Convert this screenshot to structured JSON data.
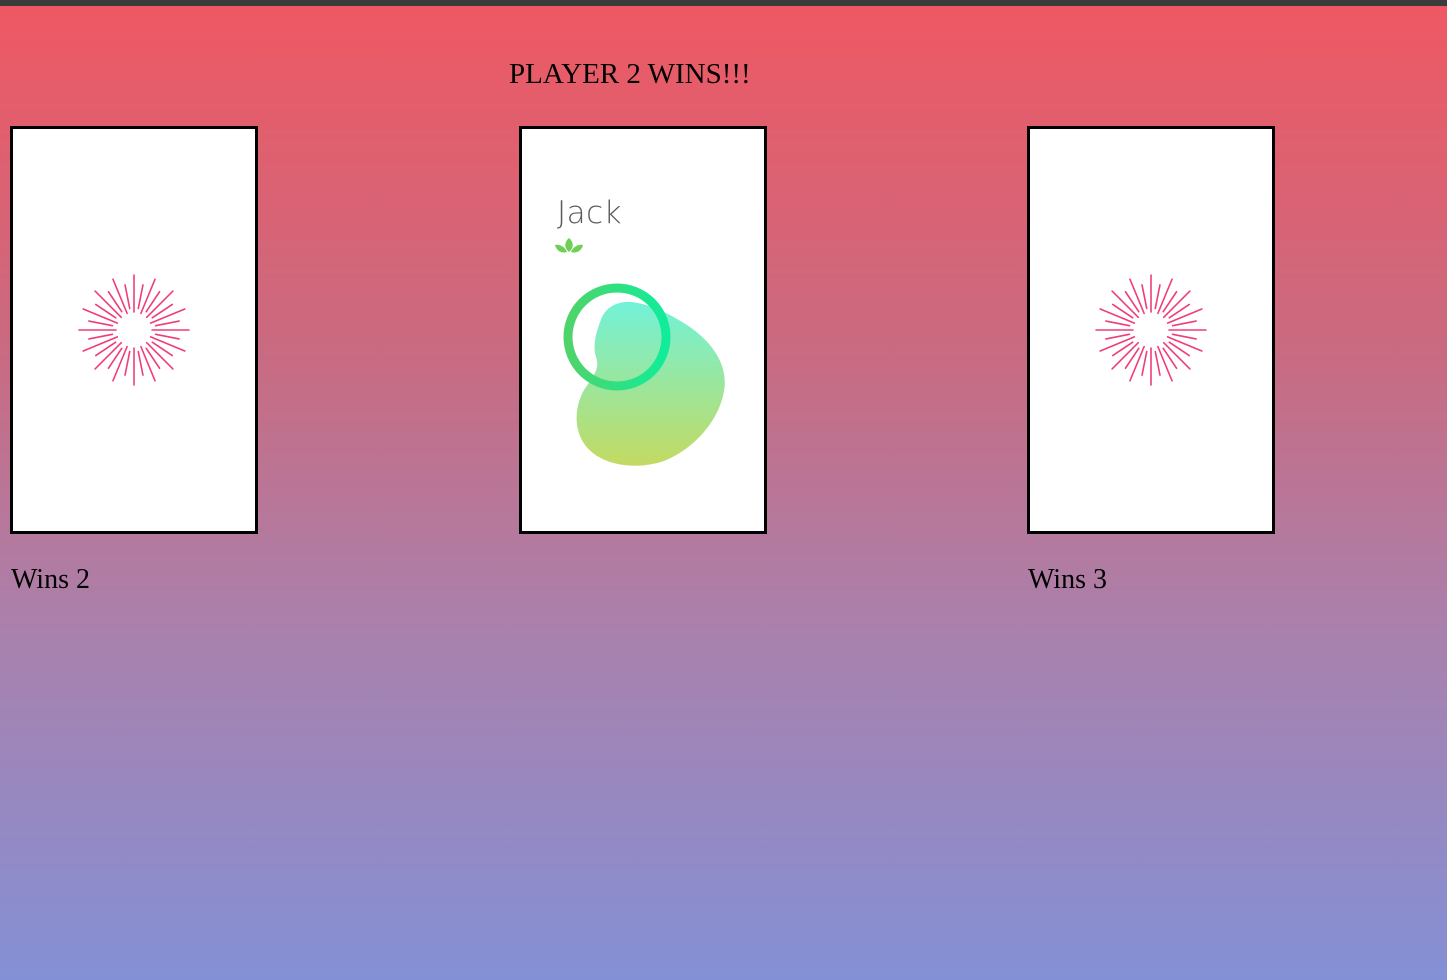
{
  "game": {
    "result_text": "PLAYER 2 WINS!!!",
    "player1": {
      "wins_text": "Wins 2",
      "card_state": "face-down"
    },
    "player2": {
      "wins_text": "Wins 3",
      "card_state": "face-down"
    },
    "center_card": {
      "name": "Jack",
      "suit_icon": "leaf-icon"
    },
    "colors": {
      "background_top": "#ef5862",
      "background_bottom": "#8490d6",
      "card_back_burst": "#ee3d7a",
      "ring": "#19e07f",
      "blob_top": "#72f2d8",
      "blob_bottom": "#c3da62",
      "leaf": "#6fcf55"
    }
  }
}
